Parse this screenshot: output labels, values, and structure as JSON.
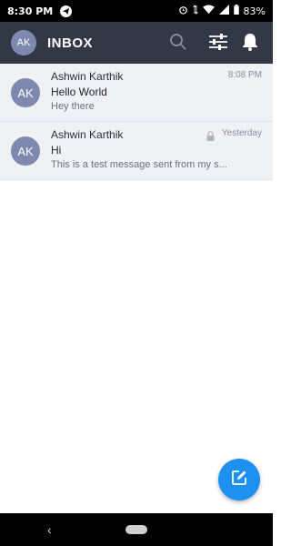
{
  "status_bar": {
    "time": "8:30 PM",
    "battery": "83%",
    "icons": [
      "telegram-icon",
      "alarm-icon",
      "data-arrows-icon",
      "wifi-icon",
      "signal-icon",
      "battery-icon"
    ]
  },
  "app_bar": {
    "avatar_initials": "AK",
    "title": "INBOX",
    "icons": [
      "search-icon",
      "filter-icon",
      "bell-icon"
    ],
    "color": "#343846"
  },
  "messages": [
    {
      "avatar_initials": "AK",
      "sender": "Ashwin Karthik",
      "subject": "Hello World",
      "snippet": "Hey there",
      "date": "8:08 PM",
      "locked": false
    },
    {
      "avatar_initials": "AK",
      "sender": "Ashwin Karthik",
      "subject": "Hi",
      "snippet": "This is a test message sent from my s...",
      "date": "Yesterday",
      "locked": true
    }
  ],
  "fab": {
    "icon": "compose-icon",
    "color": "#1e90f0"
  },
  "nav_bar": {
    "icons": [
      "back-icon",
      "home-pill"
    ]
  }
}
